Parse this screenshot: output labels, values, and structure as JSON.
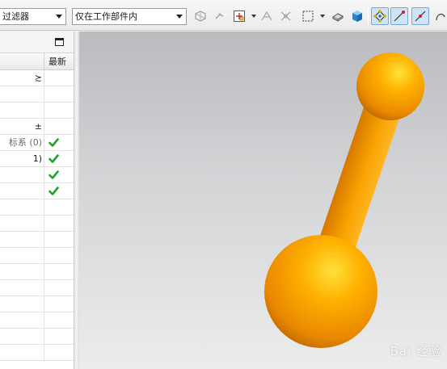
{
  "toolbar": {
    "type_filter": {
      "value": "过滤器"
    },
    "scope_filter": {
      "value": "仅在工作部件内"
    },
    "icons": [
      "component-select-icon",
      "snap-point-icon",
      "point-constructor-icon",
      "curve-rule-icon",
      "intersection-icon",
      "rectangle-select-icon",
      "view-orient-icon",
      "shaded-cube-icon",
      "snap-control-point-icon",
      "snap-endpoint-icon",
      "snap-midpoint-icon",
      "snap-arc-center-icon"
    ]
  },
  "navigator": {
    "latest_header": "最新",
    "rows": [
      {
        "name": "≿",
        "dim": false,
        "latest": false
      },
      {
        "name": "",
        "dim": false,
        "latest": false
      },
      {
        "name": "",
        "dim": false,
        "latest": false
      },
      {
        "name": "±",
        "dim": false,
        "latest": false
      },
      {
        "name": "标系 (0)",
        "dim": true,
        "latest": true
      },
      {
        "name": "1)",
        "dim": false,
        "latest": true
      },
      {
        "name": "",
        "dim": false,
        "latest": true
      },
      {
        "name": "",
        "dim": false,
        "latest": true
      },
      {
        "name": "",
        "dim": false,
        "latest": false
      },
      {
        "name": "",
        "dim": false,
        "latest": false
      },
      {
        "name": "",
        "dim": false,
        "latest": false
      },
      {
        "name": "",
        "dim": false,
        "latest": false
      },
      {
        "name": "",
        "dim": false,
        "latest": false
      },
      {
        "name": "",
        "dim": false,
        "latest": false
      },
      {
        "name": "",
        "dim": false,
        "latest": false
      },
      {
        "name": "",
        "dim": false,
        "latest": false
      },
      {
        "name": "",
        "dim": false,
        "latest": false
      },
      {
        "name": "",
        "dim": false,
        "latest": false
      }
    ]
  },
  "viewport": {
    "model": "dumbbell-solid",
    "body_color": "#f59a00",
    "highlight_color": "#ffe23a",
    "background_top": "#b9bbbe",
    "background_bottom": "#ececec",
    "watermark": "Bai 经验"
  }
}
